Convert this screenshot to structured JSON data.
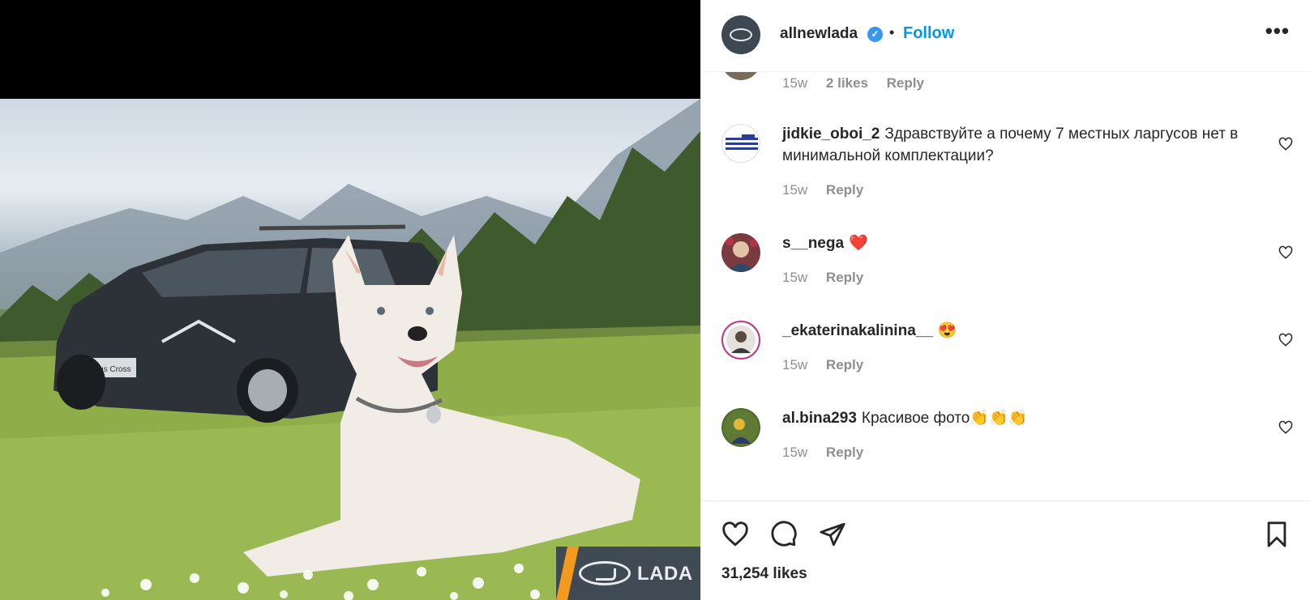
{
  "post": {
    "username": "allnewlada",
    "verified_mark": "✓",
    "separator": "•",
    "follow_label": "Follow",
    "more_label": "•••",
    "likes_count": "31,254 likes"
  },
  "media": {
    "brand_label": "LADA",
    "plate_text": "Largus Cross"
  },
  "prev_comment_meta": {
    "age": "15w",
    "likes": "2 likes",
    "reply": "Reply"
  },
  "comments": [
    {
      "user": "jidkie_oboi_2",
      "text": "Здравствуйте а почему 7 местных ларгусов нет в минимальной комплектации?",
      "age": "15w",
      "reply": "Reply"
    },
    {
      "user": "s__nega",
      "text": "❤️",
      "age": "15w",
      "reply": "Reply"
    },
    {
      "user": "_ekaterinakalinina__",
      "text": "😍",
      "age": "15w",
      "reply": "Reply"
    },
    {
      "user": "al.bina293",
      "text": "Красивое фото👏👏👏",
      "age": "15w",
      "reply": "Reply"
    }
  ],
  "icons": {
    "like": "heart-icon",
    "comment": "comment-icon",
    "share": "share-icon",
    "save": "bookmark-icon"
  },
  "colors": {
    "follow": "#0095f6",
    "verified": "#3897f0",
    "lada_orange": "#f39a1e"
  }
}
